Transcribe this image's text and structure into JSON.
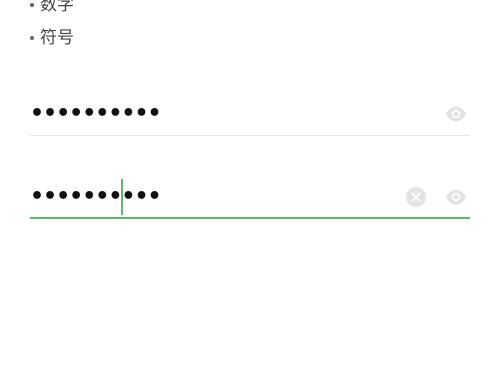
{
  "rules": [
    {
      "label": "数字"
    },
    {
      "label": "符号"
    }
  ],
  "fields": {
    "password": {
      "masked_value": "••••••••••",
      "icon": "eye-icon"
    },
    "confirm_password": {
      "masked_value": "••••••••••",
      "icons": [
        "clear-icon",
        "eye-icon"
      ]
    }
  },
  "colors": {
    "accent": "#5cba6a",
    "divider": "#e5e5e5",
    "icon_gray": "#e3e3e3"
  }
}
